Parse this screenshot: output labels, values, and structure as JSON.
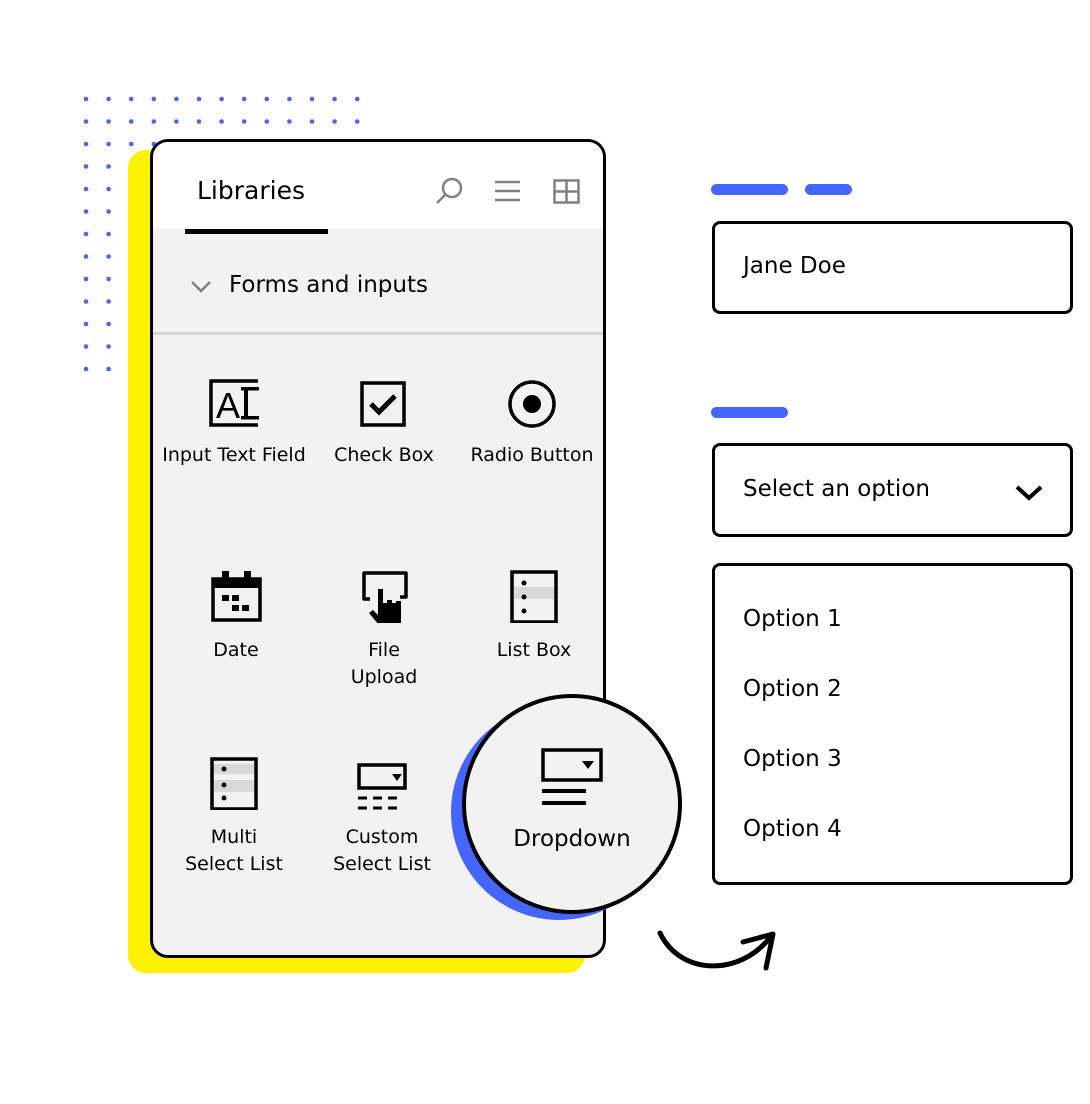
{
  "colors": {
    "accent": "#4466ff",
    "highlight": "#fff200",
    "panel_bg": "#f2f2f2"
  },
  "panel": {
    "tab_label": "Libraries",
    "header_icons": [
      "search-icon",
      "list-view-icon",
      "grid-view-icon"
    ],
    "section_title": "Forms and inputs",
    "items": [
      {
        "label": "Input Text Field",
        "icon": "text-field-icon"
      },
      {
        "label": "Check Box",
        "icon": "checkbox-icon"
      },
      {
        "label": "Radio Button",
        "icon": "radio-icon"
      },
      {
        "label": "Date",
        "icon": "calendar-icon"
      },
      {
        "label": "File Upload",
        "icon": "file-upload-icon"
      },
      {
        "label": "List Box",
        "icon": "list-box-icon"
      },
      {
        "label": "Multi Select List",
        "icon": "multi-select-icon"
      },
      {
        "label": "Custom Select List",
        "icon": "custom-select-icon"
      }
    ],
    "highlighted_item": {
      "label": "Dropdown",
      "icon": "dropdown-icon"
    }
  },
  "preview": {
    "text_input_value": "Jane Doe",
    "select_value": "Select an option",
    "options": [
      "Option 1",
      "Option 2",
      "Option 3",
      "Option 4"
    ]
  }
}
